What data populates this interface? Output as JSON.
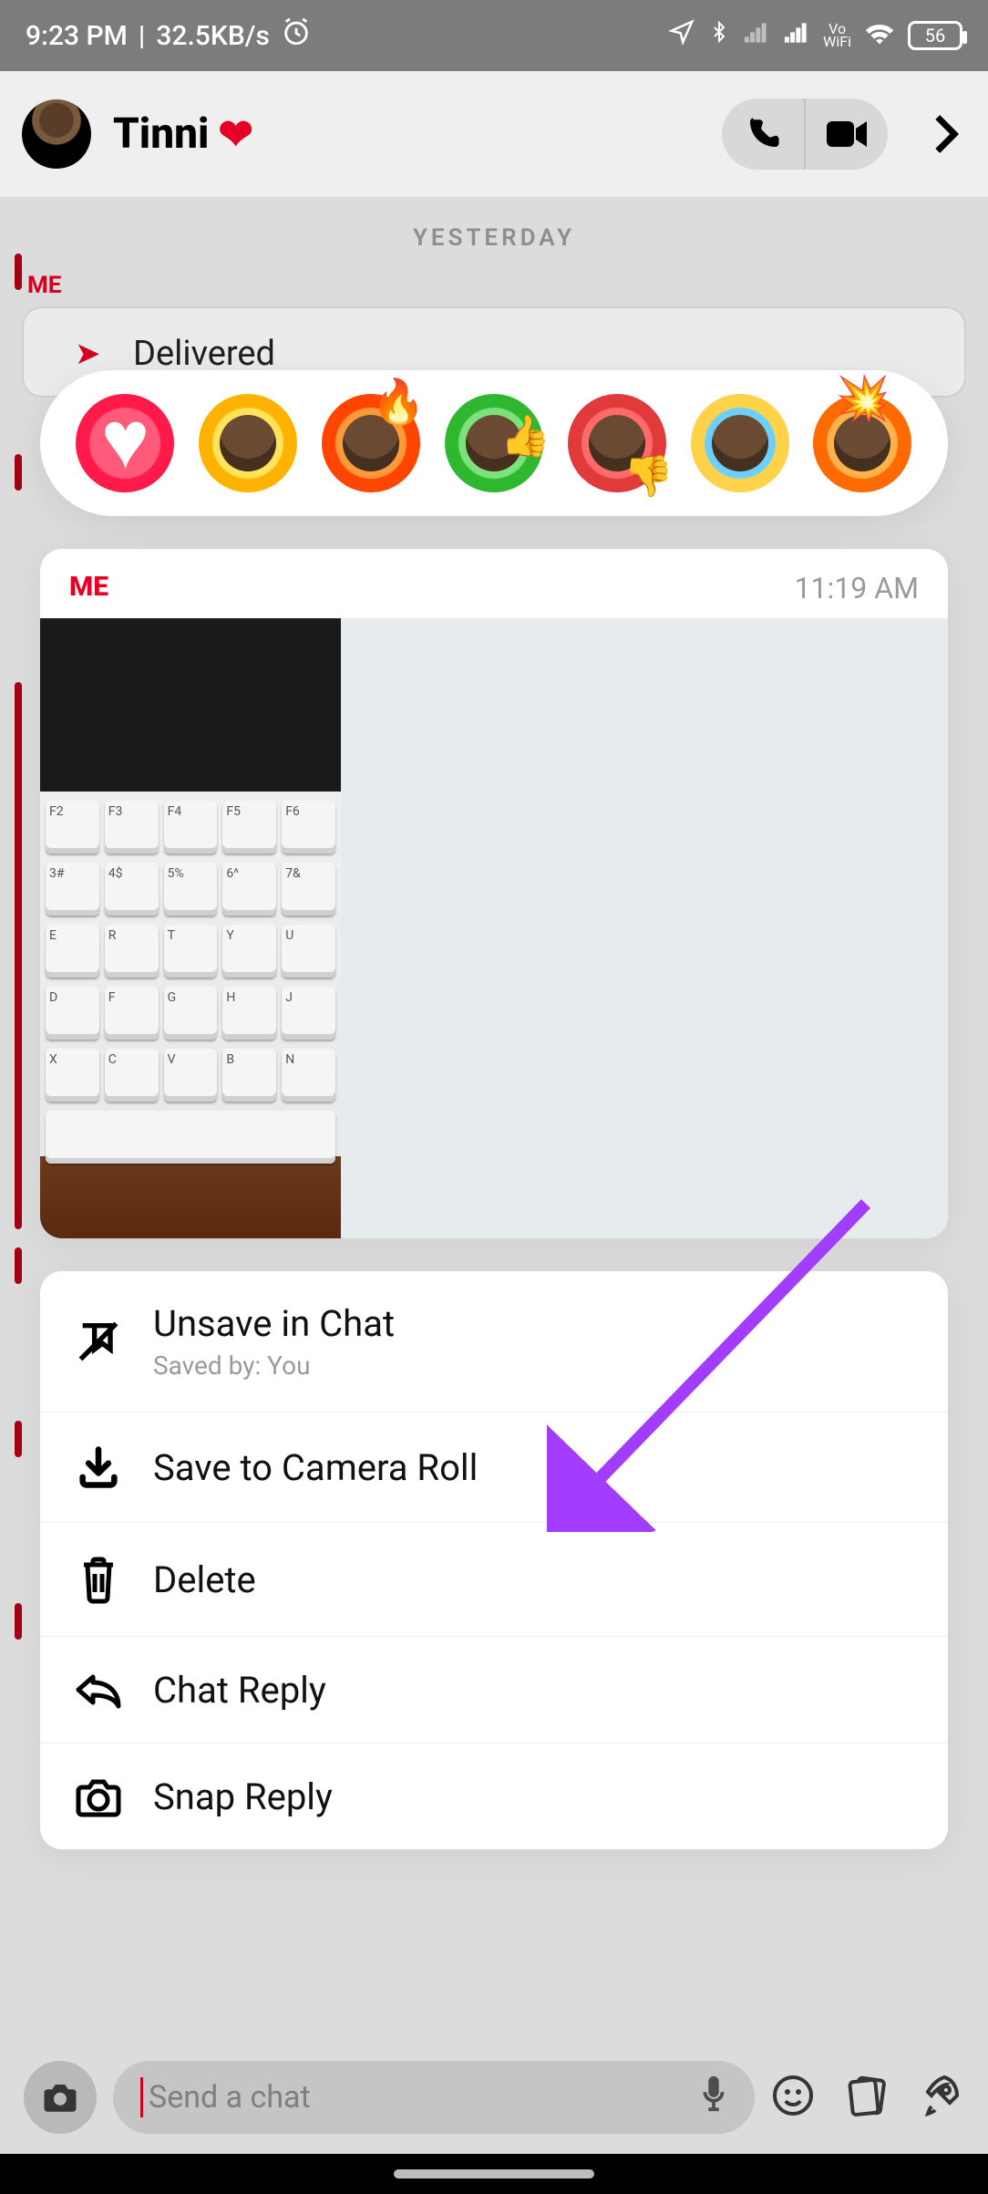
{
  "statusbar": {
    "time": "9:23 PM",
    "net": "32.5KB/s",
    "vowifi": "Vo\nWiFi",
    "battery": "56"
  },
  "header": {
    "title": "Tinni"
  },
  "conversation": {
    "date_separator": "YESTERDAY",
    "sender_label": "ME",
    "delivered": "Delivered"
  },
  "message": {
    "sender": "ME",
    "time": "11:19 AM"
  },
  "menu": {
    "unsave": {
      "label": "Unsave in Chat",
      "sub": "Saved by: You"
    },
    "save_camera_roll": {
      "label": "Save to Camera Roll"
    },
    "delete": {
      "label": "Delete"
    },
    "chat_reply": {
      "label": "Chat Reply"
    },
    "snap_reply": {
      "label": "Snap Reply"
    }
  },
  "input": {
    "placeholder": "Send a chat"
  }
}
